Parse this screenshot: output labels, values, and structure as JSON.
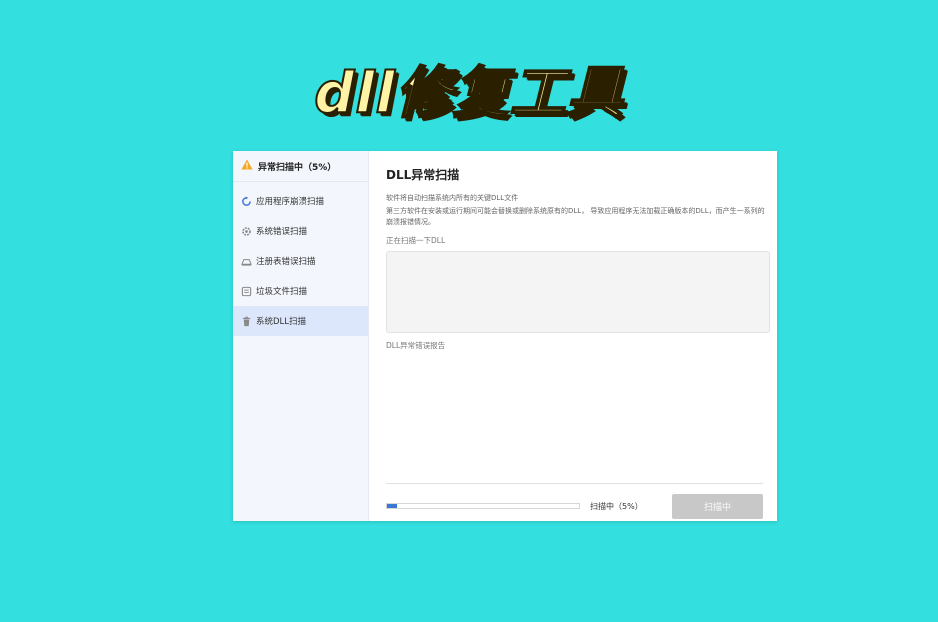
{
  "banner": {
    "title": "dll修复工具"
  },
  "sidebar": {
    "status": "异常扫描中（5%）",
    "items": [
      {
        "label": "应用程序崩溃扫描",
        "icon": "refresh-icon"
      },
      {
        "label": "系统错误扫描",
        "icon": "gear-icon"
      },
      {
        "label": "注册表错误扫描",
        "icon": "registry-icon"
      },
      {
        "label": "垃圾文件扫描",
        "icon": "file-icon"
      },
      {
        "label": "系统DLL扫描",
        "icon": "trash-icon"
      }
    ]
  },
  "main": {
    "title": "DLL异常扫描",
    "desc1": "软件将自动扫描系统内所有的关键DLL文件",
    "desc2": "第三方软件在安装或运行期间可能会替换或删除系统原有的DLL， 导致应用程序无法加载正确版本的DLL，而产生一系列的崩溃报错情况。",
    "scanning_label": "正在扫描一下DLL",
    "report_label": "DLL异常错误报告"
  },
  "progress": {
    "percent": 5,
    "text": "扫描中（5%）"
  },
  "button": {
    "label": "扫描中"
  },
  "colors": {
    "background": "#34dfe0",
    "accent": "#3a77d6",
    "warning": "#f5a623"
  }
}
